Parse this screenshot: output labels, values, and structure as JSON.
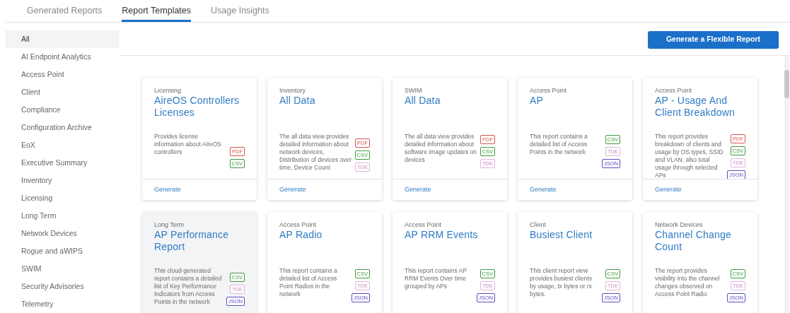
{
  "tabs": [
    {
      "label": "Generated Reports",
      "selected": false
    },
    {
      "label": "Report Templates",
      "selected": true
    },
    {
      "label": "Usage Insights",
      "selected": false
    }
  ],
  "sidebar": {
    "items": [
      {
        "label": "All",
        "selected": true
      },
      {
        "label": "AI Endpoint Analytics",
        "selected": false
      },
      {
        "label": "Access Point",
        "selected": false
      },
      {
        "label": "Client",
        "selected": false
      },
      {
        "label": "Compliance",
        "selected": false
      },
      {
        "label": "Configuration Archive",
        "selected": false
      },
      {
        "label": "EoX",
        "selected": false
      },
      {
        "label": "Executive Summary",
        "selected": false
      },
      {
        "label": "Inventory",
        "selected": false
      },
      {
        "label": "Licensing",
        "selected": false
      },
      {
        "label": "Long Term",
        "selected": false
      },
      {
        "label": "Network Devices",
        "selected": false
      },
      {
        "label": "Rogue and aWIPS",
        "selected": false
      },
      {
        "label": "SWIM",
        "selected": false
      },
      {
        "label": "Security Advisories",
        "selected": false
      },
      {
        "label": "Telemetry",
        "selected": false
      }
    ]
  },
  "primary_button": "Generate a Flexible Report",
  "cards": [
    {
      "category": "Licensing",
      "title": "AireOS Controllers Licenses",
      "description": "Provides license information about AireOS controllers",
      "highlighted": false,
      "formats": [
        {
          "kind": "pdf",
          "label": "PDF"
        },
        {
          "kind": "csv",
          "label": "CSV"
        }
      ],
      "action": "Generate"
    },
    {
      "category": "Inventory",
      "title": "All Data",
      "description": "The all data view provides detailed information about network devices, Distribution of devices over time, Device Count",
      "highlighted": false,
      "formats": [
        {
          "kind": "pdf",
          "label": "PDF"
        },
        {
          "kind": "csv",
          "label": "CSV"
        },
        {
          "kind": "tde",
          "label": "TDE"
        }
      ],
      "action": "Generate"
    },
    {
      "category": "SWIM",
      "title": "All Data",
      "description": "The all data view provides detailed information about software image updates on devices",
      "highlighted": false,
      "formats": [
        {
          "kind": "pdf",
          "label": "PDF"
        },
        {
          "kind": "csv",
          "label": "CSV"
        },
        {
          "kind": "tde",
          "label": "TDE"
        }
      ],
      "action": "Generate"
    },
    {
      "category": "Access Point",
      "title": "AP",
      "description": "This report contains a detailed list of Access Points in the network",
      "highlighted": false,
      "formats": [
        {
          "kind": "csv",
          "label": "CSV"
        },
        {
          "kind": "tde",
          "label": "TDE"
        },
        {
          "kind": "json",
          "label": "JSON"
        }
      ],
      "action": "Generate"
    },
    {
      "category": "Access Point",
      "title": "AP - Usage And Client Breakdown",
      "description": "This report provides breakdown of clients and usage by OS types, SSID and VLAN, also total usage through selected APs",
      "highlighted": false,
      "formats": [
        {
          "kind": "pdf",
          "label": "PDF"
        },
        {
          "kind": "csv",
          "label": "CSV"
        },
        {
          "kind": "tde",
          "label": "TDE"
        },
        {
          "kind": "json",
          "label": "JSON"
        }
      ],
      "action": "Generate"
    },
    {
      "category": "Long Term",
      "title": "AP Performance Report",
      "description": "This cloud-generated report contains a detailed list of Key Performance Indicators from Access Points in the network",
      "highlighted": true,
      "formats": [
        {
          "kind": "csv",
          "label": "CSV"
        },
        {
          "kind": "tde",
          "label": "TDE"
        },
        {
          "kind": "json",
          "label": "JSON"
        }
      ]
    },
    {
      "category": "Access Point",
      "title": "AP Radio",
      "description": "This report contains a detailed list of Access Point Radios in the network",
      "highlighted": false,
      "formats": [
        {
          "kind": "csv",
          "label": "CSV"
        },
        {
          "kind": "tde",
          "label": "TDE"
        },
        {
          "kind": "json",
          "label": "JSON"
        }
      ]
    },
    {
      "category": "Access Point",
      "title": "AP RRM Events",
      "description": "This report contains AP RRM Events Over time grouped by APs",
      "highlighted": false,
      "formats": [
        {
          "kind": "csv",
          "label": "CSV"
        },
        {
          "kind": "tde",
          "label": "TDE"
        },
        {
          "kind": "json",
          "label": "JSON"
        }
      ]
    },
    {
      "category": "Client",
      "title": "Busiest Client",
      "description": "This client report view provides busiest clients by usage, tx bytes or rx bytes.",
      "highlighted": false,
      "formats": [
        {
          "kind": "csv",
          "label": "CSV"
        },
        {
          "kind": "tde",
          "label": "TDE"
        },
        {
          "kind": "json",
          "label": "JSON"
        }
      ]
    },
    {
      "category": "Network Devices",
      "title": "Channel Change Count",
      "description": "The report provides visibility into the channel changes observed on Access Point Radio",
      "highlighted": false,
      "formats": [
        {
          "kind": "csv",
          "label": "CSV"
        },
        {
          "kind": "tde",
          "label": "TDE"
        },
        {
          "kind": "json",
          "label": "JSON"
        }
      ]
    }
  ]
}
